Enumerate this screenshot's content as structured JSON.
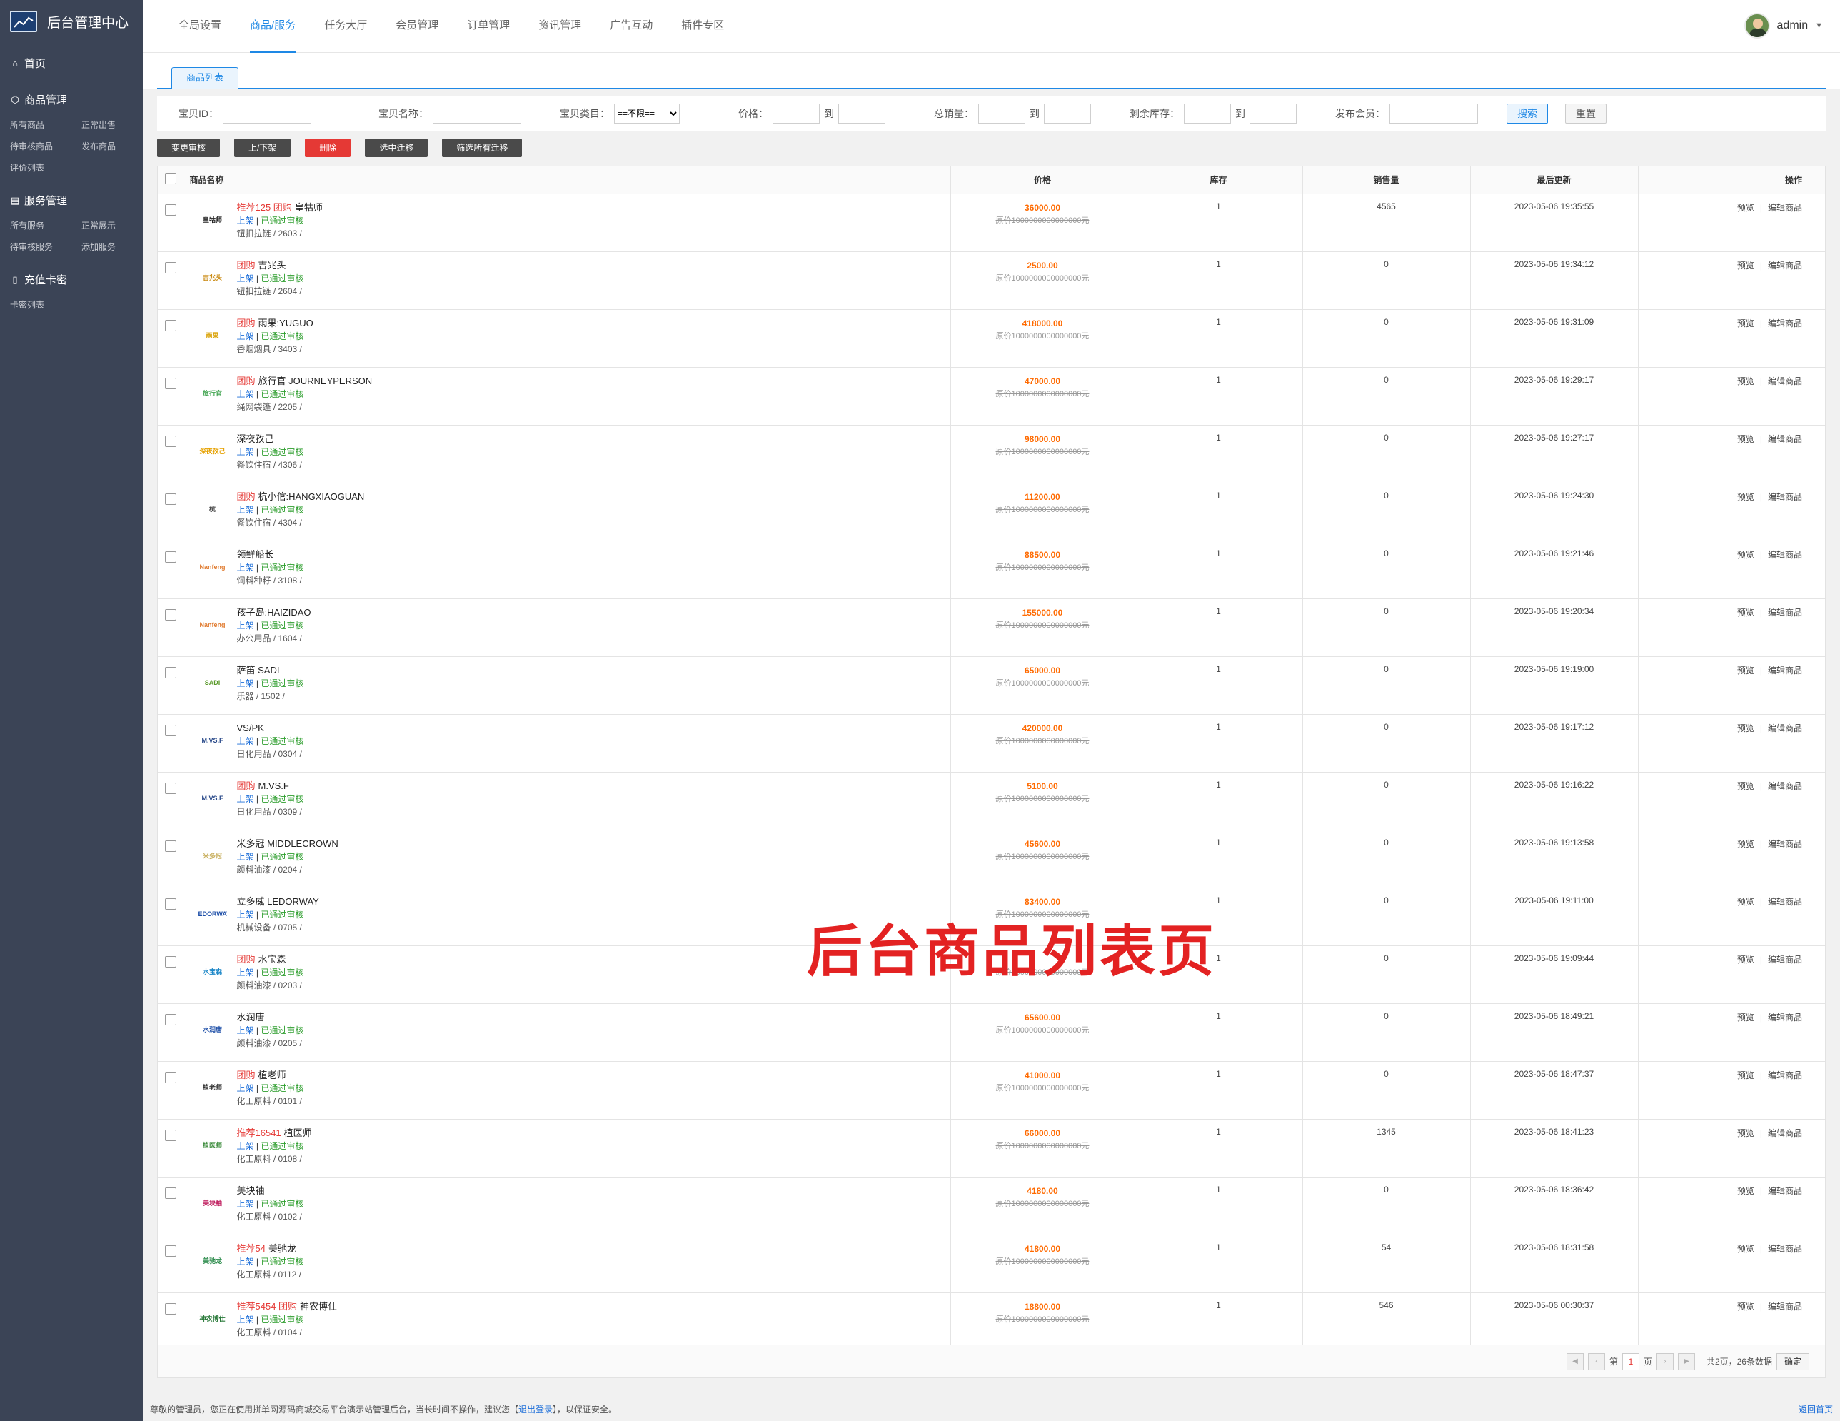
{
  "sidebar": {
    "brand": "后台管理中心",
    "home": "首页",
    "groups": [
      {
        "title": "商品管理",
        "items": [
          "所有商品",
          "正常出售",
          "待审核商品",
          "发布商品",
          "评价列表"
        ]
      },
      {
        "title": "服务管理",
        "items": [
          "所有服务",
          "正常展示",
          "待审核服务",
          "添加服务"
        ]
      },
      {
        "title": "充值卡密",
        "items": [
          "卡密列表"
        ]
      }
    ]
  },
  "topnav": {
    "items": [
      "全局设置",
      "商品/服务",
      "任务大厅",
      "会员管理",
      "订单管理",
      "资讯管理",
      "广告互动",
      "插件专区"
    ],
    "active_index": 1
  },
  "user": {
    "name": "admin"
  },
  "tab": {
    "label": "商品列表"
  },
  "filter": {
    "id_label": "宝贝ID：",
    "name_label": "宝贝名称：",
    "category_label": "宝贝类目：",
    "category_value": "==不限==",
    "price_label": "价格：",
    "to": "到",
    "sales_label": "总销量：",
    "stock_label": "剩余库存：",
    "member_label": "发布会员：",
    "search_btn": "搜索",
    "reset_btn": "重置"
  },
  "actions": [
    "变更审核",
    "上/下架",
    "删除",
    "选中迁移",
    "筛选所有迁移"
  ],
  "table": {
    "headers": {
      "name": "商品名称",
      "price": "价格",
      "stock": "库存",
      "sales": "销售量",
      "updated": "最后更新",
      "ops": "操作"
    },
    "status_on": "上架",
    "status_sep": "|",
    "status_ok": "已通过审核",
    "old_price": "原价1000000000000000元",
    "op_preview": "预览",
    "op_edit": "编辑商品",
    "rows": [
      {
        "tags": "推荐125 团购",
        "name": "皇牯师",
        "cat": "钮扣拉链 / 2603 /",
        "price": "36000.00",
        "stock": "1",
        "sales": "4565",
        "time": "2023-05-06 19:35:55",
        "logo": "皇牯师",
        "logo_color": "#222"
      },
      {
        "tags": "团购",
        "name": "吉兆头",
        "cat": "钮扣拉链 / 2604 /",
        "price": "2500.00",
        "stock": "1",
        "sales": "0",
        "time": "2023-05-06 19:34:12",
        "logo": "吉兆头",
        "logo_color": "#c8860a"
      },
      {
        "tags": "团购",
        "name": "雨果:YUGUO",
        "cat": "香烟烟具 / 3403 /",
        "price": "418000.00",
        "stock": "1",
        "sales": "0",
        "time": "2023-05-06 19:31:09",
        "logo": "雨果",
        "logo_color": "#d9a000"
      },
      {
        "tags": "团购",
        "name": "旅行官 JOURNEYPERSON",
        "cat": "绳网袋篷 / 2205 /",
        "price": "47000.00",
        "stock": "1",
        "sales": "0",
        "time": "2023-05-06 19:29:17",
        "logo": "旅行官",
        "logo_color": "#3aa14a"
      },
      {
        "tags": "",
        "name": "深夜孜己",
        "cat": "餐饮住宿 / 4306 /",
        "price": "98000.00",
        "stock": "1",
        "sales": "0",
        "time": "2023-05-06 19:27:17",
        "logo": "深夜孜己",
        "logo_color": "#e6a100"
      },
      {
        "tags": "团购",
        "name": "杭小倌:HANGXIAOGUAN",
        "cat": "餐饮住宿 / 4304 /",
        "price": "11200.00",
        "stock": "1",
        "sales": "0",
        "time": "2023-05-06 19:24:30",
        "logo": "杭",
        "logo_color": "#444"
      },
      {
        "tags": "",
        "name": "领鲜船长",
        "cat": "饲料种籽 / 3108 /",
        "price": "88500.00",
        "stock": "1",
        "sales": "0",
        "time": "2023-05-06 19:21:46",
        "logo": "Nanfeng",
        "logo_color": "#e07a2e"
      },
      {
        "tags": "",
        "name": "孩子岛:HAIZIDAO",
        "cat": "办公用品 / 1604 /",
        "price": "155000.00",
        "stock": "1",
        "sales": "0",
        "time": "2023-05-06 19:20:34",
        "logo": "Nanfeng",
        "logo_color": "#e07a2e"
      },
      {
        "tags": "",
        "name": "萨笛 SADI",
        "cat": "乐器 / 1502 /",
        "price": "65000.00",
        "stock": "1",
        "sales": "0",
        "time": "2023-05-06 19:19:00",
        "logo": "SADI",
        "logo_color": "#5a9a2a"
      },
      {
        "tags": "",
        "name": "VS/PK",
        "cat": "日化用品 / 0304 /",
        "price": "420000.00",
        "stock": "1",
        "sales": "0",
        "time": "2023-05-06 19:17:12",
        "logo": "M.VS.F",
        "logo_color": "#2a4a8a"
      },
      {
        "tags": "团购",
        "name": "M.VS.F",
        "cat": "日化用品 / 0309 /",
        "price": "5100.00",
        "stock": "1",
        "sales": "0",
        "time": "2023-05-06 19:16:22",
        "logo": "M.VS.F",
        "logo_color": "#2a4a8a"
      },
      {
        "tags": "",
        "name": "米多冠 MIDDLECROWN",
        "cat": "颜料油漆 / 0204 /",
        "price": "45600.00",
        "stock": "1",
        "sales": "0",
        "time": "2023-05-06 19:13:58",
        "logo": "米多冠",
        "logo_color": "#c9b060"
      },
      {
        "tags": "",
        "name": "立多威 LEDORWAY",
        "cat": "机械设备 / 0705 /",
        "price": "83400.00",
        "stock": "1",
        "sales": "0",
        "time": "2023-05-06 19:11:00",
        "logo": "LEDORWAY",
        "logo_color": "#1e4fa8"
      },
      {
        "tags": "团购",
        "name": "水宝森",
        "cat": "颜料油漆 / 0203 /",
        "price": "",
        "stock": "1",
        "sales": "0",
        "time": "2023-05-06 19:09:44",
        "logo": "水宝森",
        "logo_color": "#1e88c8"
      },
      {
        "tags": "",
        "name": "水润唐",
        "cat": "颜料油漆 / 0205 /",
        "price": "65600.00",
        "stock": "1",
        "sales": "0",
        "time": "2023-05-06 18:49:21",
        "logo": "水润唐",
        "logo_color": "#1e4fa8"
      },
      {
        "tags": "团购",
        "name": "植老师",
        "cat": "化工原料 / 0101 /",
        "price": "41000.00",
        "stock": "1",
        "sales": "0",
        "time": "2023-05-06 18:47:37",
        "logo": "植老师",
        "logo_color": "#333"
      },
      {
        "tags": "推荐16541",
        "name": "植医师",
        "cat": "化工原料 / 0108 /",
        "price": "66000.00",
        "stock": "1",
        "sales": "1345",
        "time": "2023-05-06 18:41:23",
        "logo": "植医师",
        "logo_color": "#3a8a3a"
      },
      {
        "tags": "",
        "name": "美块袖",
        "cat": "化工原料 / 0102 /",
        "price": "4180.00",
        "stock": "1",
        "sales": "0",
        "time": "2023-05-06 18:36:42",
        "logo": "美块袖",
        "logo_color": "#c02060"
      },
      {
        "tags": "推荐54",
        "name": "美驰龙",
        "cat": "化工原料 / 0112 /",
        "price": "41800.00",
        "stock": "1",
        "sales": "54",
        "time": "2023-05-06 18:31:58",
        "logo": "美驰龙",
        "logo_color": "#2a8a4a"
      },
      {
        "tags": "推荐5454 团购",
        "name": "神农博仕",
        "cat": "化工原料 / 0104 /",
        "price": "18800.00",
        "stock": "1",
        "sales": "546",
        "time": "2023-05-06 00:30:37",
        "logo": "神农博仕",
        "logo_color": "#2a7a3a"
      }
    ]
  },
  "pager": {
    "page_prefix": "第",
    "page": "1",
    "page_suffix": "页",
    "summary": "共2页，26条数据",
    "ok": "确定"
  },
  "watermark": "后台商品列表页",
  "footer": {
    "text_before": "尊敬的管理员，您正在使用拼单网源码商城交易平台演示站管理后台，当长时间不操作，建议您【",
    "logout": "退出登录",
    "text_after": "】，以保证安全。",
    "back_home": "返回首页"
  }
}
